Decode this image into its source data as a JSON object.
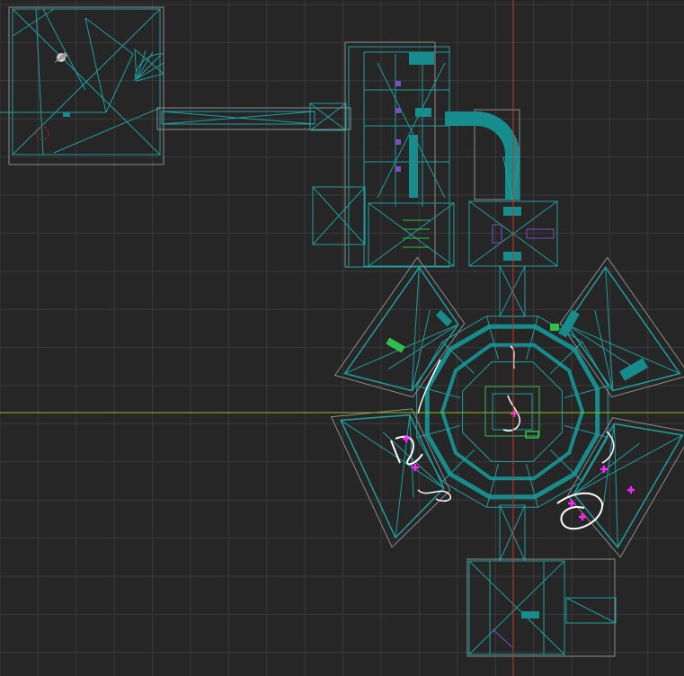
{
  "viewport": {
    "name": "level-editor-2d-viewport",
    "background_color": "#262626",
    "grid_color": "#3a3a3a",
    "axis_vertical_color": "#c0392b",
    "axis_horizontal_color": "#8fc31f"
  },
  "colors": {
    "wireframe": "#1f9e9e",
    "wireframe_bright": "#22b8b8",
    "solid_fill": "#178c8c",
    "bounds": "#8c8c8c",
    "white_path": "#ffffff",
    "magenta": "#ff22ff",
    "purple": "#7a4fc0",
    "green": "#2fbf4f",
    "red_marker": "#b02222"
  },
  "icons": {
    "player_start": "player-start-icon",
    "entity_marker": "entity-marker-icon"
  }
}
